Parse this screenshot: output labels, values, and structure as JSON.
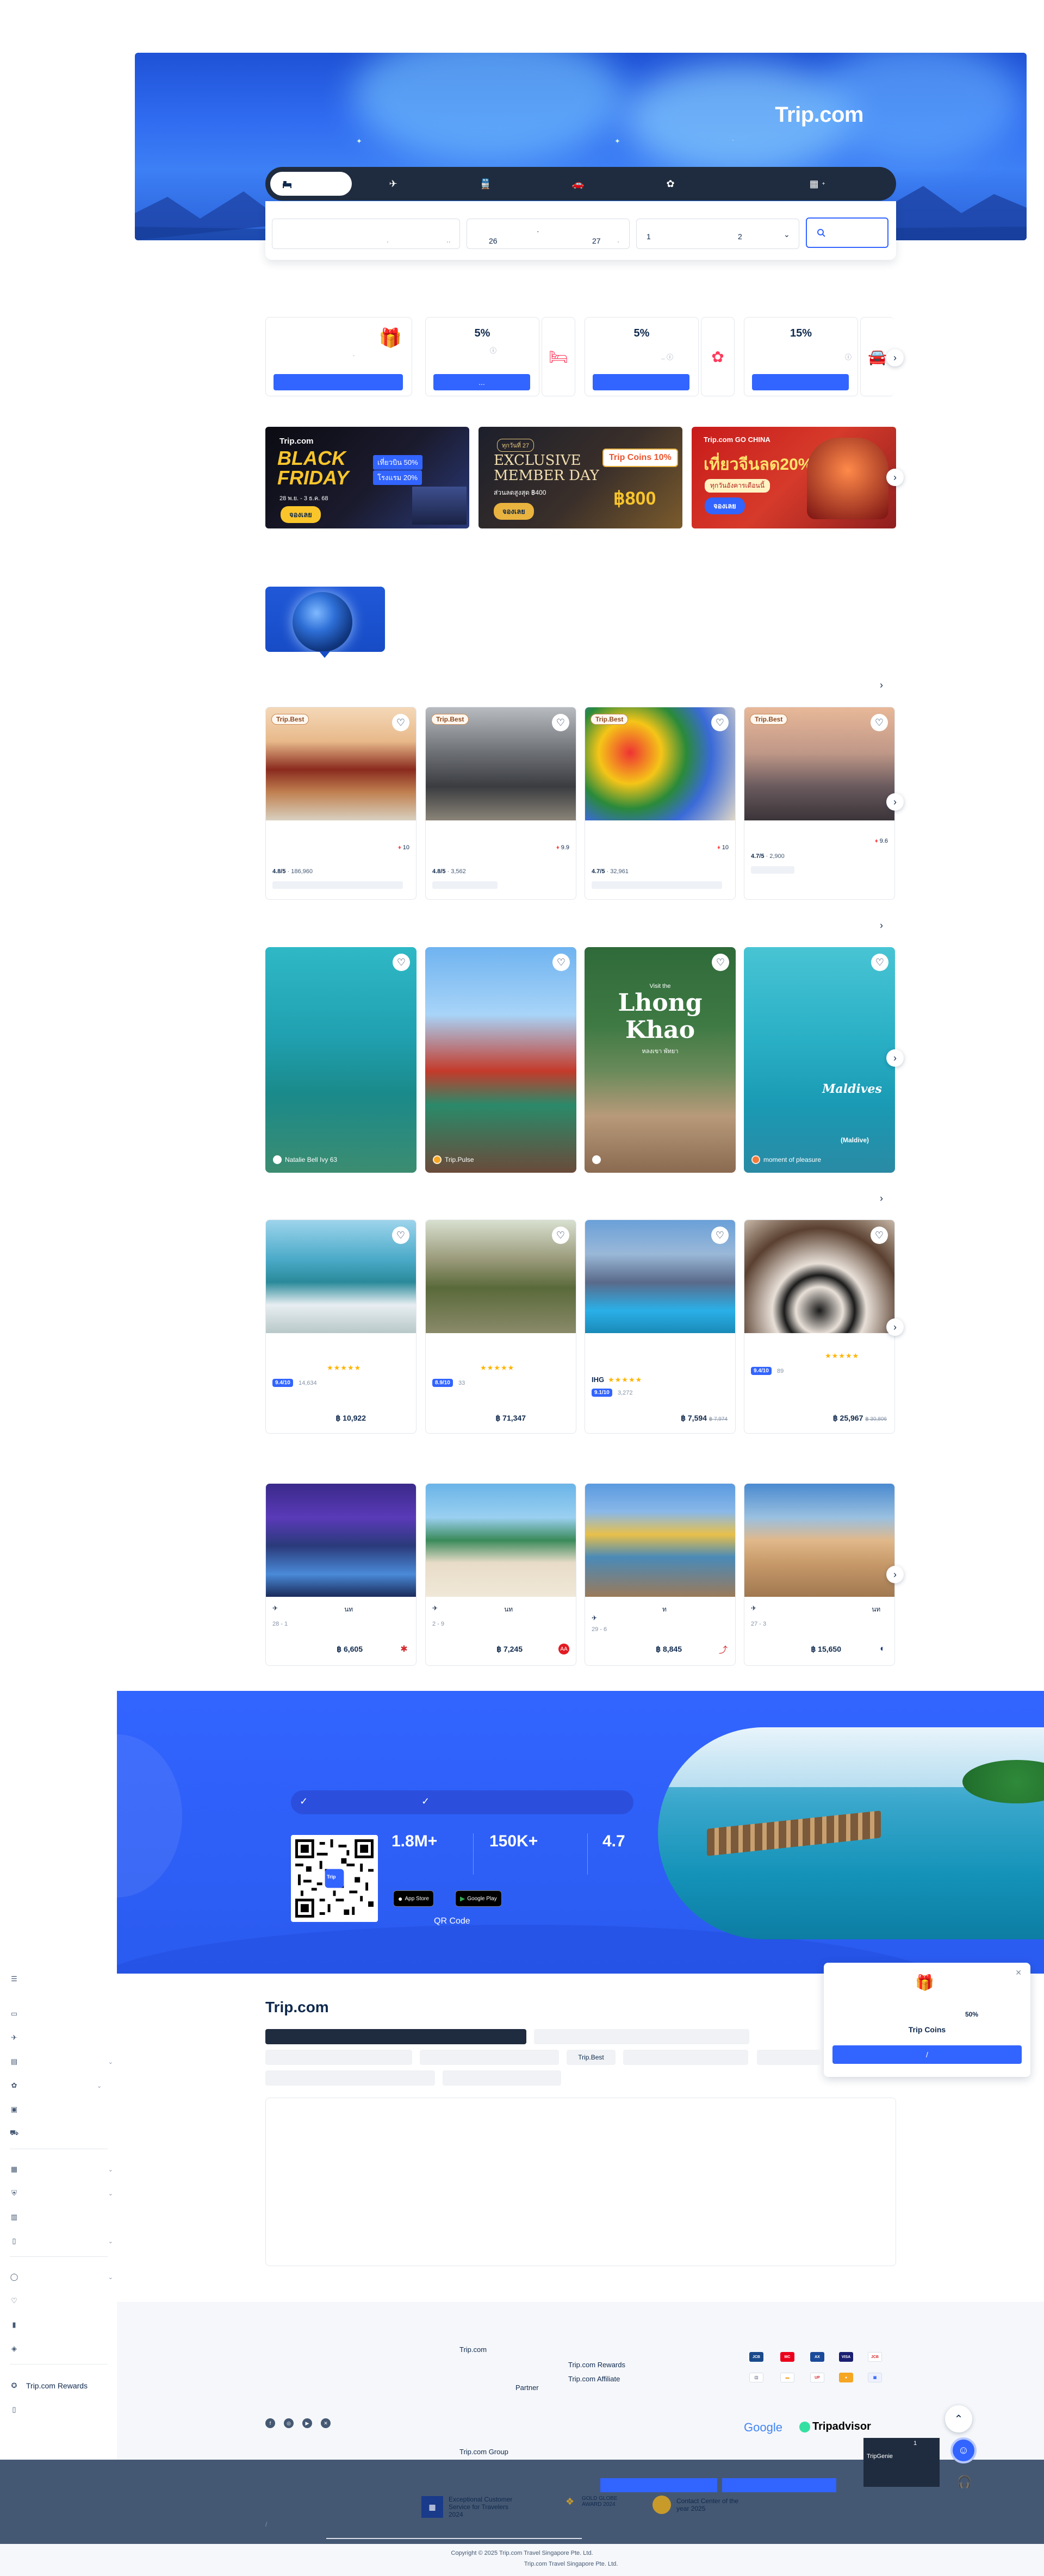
{
  "hero": {
    "logo": "Trip.com",
    "tabs": [
      {
        "icon": "hotel-icon",
        "label": ""
      },
      {
        "icon": "plane-icon",
        "label": ""
      },
      {
        "icon": "train-icon",
        "label": ""
      },
      {
        "icon": "car-icon",
        "label": ""
      },
      {
        "icon": "attraction-icon",
        "label": ""
      },
      {
        "icon": "building-icon",
        "label": ""
      }
    ],
    "search": {
      "checkin_day": "26",
      "checkout_day": "27",
      "rooms": "1",
      "guests": "2"
    }
  },
  "coupons": [
    {
      "percent": "",
      "icon": "gift-icon"
    },
    {
      "percent": "5%",
      "icon": "bed-icon"
    },
    {
      "percent": "5%",
      "icon": "ticket-icon"
    },
    {
      "percent": "15%",
      "icon": "car-icon"
    }
  ],
  "promos": [
    {
      "brand": "Trip.com",
      "title": "BLACK FRIDAY",
      "line1": "เที่ยวบิน 50%",
      "line2": "โรงแรม 20%",
      "date": "28 พ.ย. - 3 ธ.ค. 68",
      "cta": "จองเลย"
    },
    {
      "brand": "",
      "title": "EXCLUSIVE MEMBER DAY",
      "badge": "Trip Coins 10%",
      "sub": "ส่วนลดสูงสุด ฿400",
      "amount": "฿800",
      "cta": "จองเลย"
    },
    {
      "brand": "Trip.com GO CHINA",
      "title": "เที่ยวจีนลด20%",
      "sub": "ทุกวันอังคารเดือนนี้",
      "cta": "จองเลย"
    }
  ],
  "attractions": [
    {
      "badge": "Trip.Best",
      "rank": "10",
      "rating": "4.8/5",
      "reviews": "186,960"
    },
    {
      "badge": "Trip.Best",
      "rank": "9.9",
      "rating": "4.8/5",
      "reviews": "3,562"
    },
    {
      "badge": "Trip.Best",
      "rank": "10",
      "rating": "4.7/5",
      "reviews": "32,961"
    },
    {
      "badge": "Trip.Best",
      "rank": "9.6",
      "rating": "4.7/5",
      "reviews": "2,900"
    }
  ],
  "photos": [
    {
      "author": "Natalie Bell Ivy 63",
      "overlay": ""
    },
    {
      "author": "Trip.Pulse",
      "overlay": ""
    },
    {
      "author": "",
      "overlay_top": "Visit the",
      "overlay": "Lhong Khao",
      "overlay_sub": "หลงเขา พัทยา"
    },
    {
      "author": "moment of pleasure",
      "overlay": "Maldives",
      "overlay_sub": "(Maldive)"
    }
  ],
  "hotels": [
    {
      "stars": "★★★★★",
      "score": "9.4/10",
      "reviews": "14,634",
      "price": "฿ 10,922",
      "old": ""
    },
    {
      "stars": "★★★★★",
      "score": "8.9/10",
      "reviews": "33",
      "price": "฿ 71,347",
      "old": ""
    },
    {
      "brand": "IHG",
      "stars": "★★★★★",
      "score": "9.1/10",
      "reviews": "3,272",
      "price": "฿ 7,594",
      "old": "฿ 7,974"
    },
    {
      "stars": "★★★★★",
      "score": "9.4/10",
      "reviews": "89",
      "price": "฿ 25,967",
      "old": "฿ 30,806"
    }
  ],
  "flights": [
    {
      "dates": "28 - 1",
      "price": "฿ 6,605"
    },
    {
      "dates": "2 - 9",
      "price": "฿ 7,245"
    },
    {
      "dates": "29 - 6",
      "price": "฿ 8,845"
    },
    {
      "dates": "27 - 3",
      "price": "฿ 15,650"
    }
  ],
  "app": {
    "stats": [
      "1.8M+",
      "150K+",
      "4.7"
    ],
    "appstore": "App Store",
    "googleplay": "Google Play",
    "qr_label": "QR Code",
    "qr_center": "Trip"
  },
  "coin_popup": {
    "pct": "50%",
    "title": "Trip Coins",
    "btn": "/"
  },
  "sidebar": {
    "items": [
      "",
      "",
      "",
      "",
      "",
      "",
      "",
      "",
      "",
      "",
      "",
      "",
      "",
      "",
      "",
      "Trip.com Rewards",
      ""
    ]
  },
  "info": {
    "brand": "Trip.com",
    "pill_best": "Trip.Best"
  },
  "footer": {
    "col_title": "Trip.com",
    "partner": "Partner",
    "rewards": "Trip.com Rewards",
    "affiliate": "Trip.com Affiliate",
    "group": "Trip.com Group",
    "google": "Google",
    "tripadvisor": "Tripadvisor",
    "award1": "Exceptional Customer Service for Travelers 2024",
    "award2": "GOLD GLOBE AWARD 2024",
    "award3": "Contact Center of the year 2025",
    "copyright": "Copyright © 2025 Trip.com Travel Singapore Pte. Ltd.",
    "company": "Trip.com Travel Singapore Pte. Ltd.",
    "chat_label": "TripGenie",
    "chat_num": "1"
  }
}
